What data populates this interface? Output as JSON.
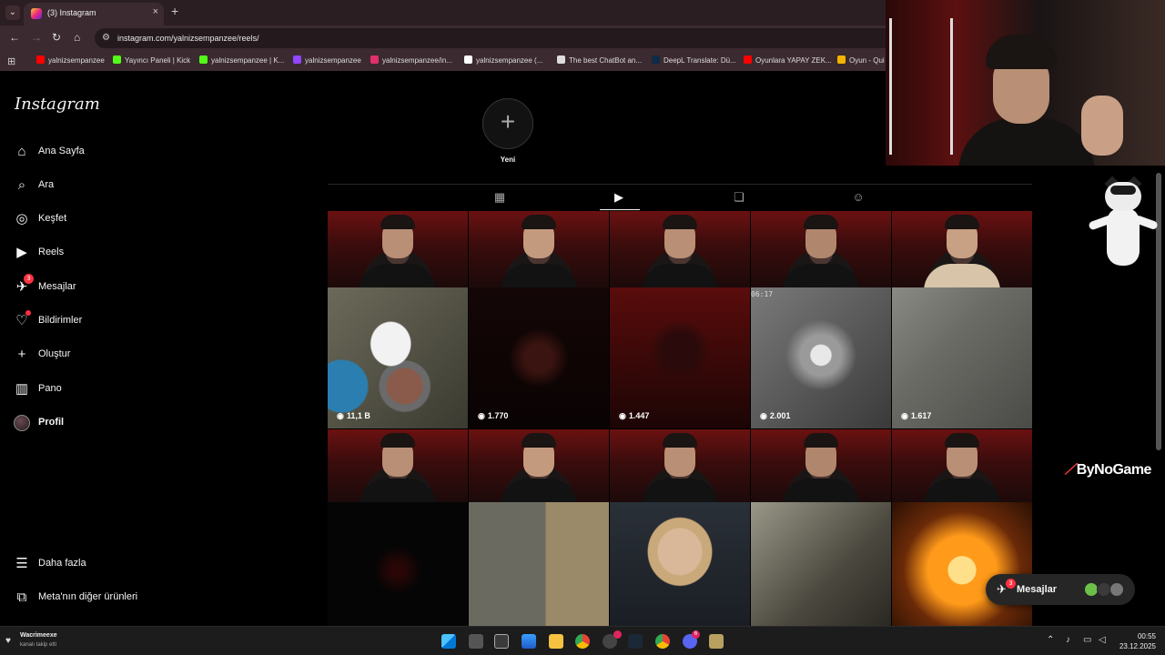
{
  "browser": {
    "tab_title": "(3) Instagram",
    "url": "instagram.com/yalnizsempanzee/reels/",
    "bookmarks": [
      {
        "label": "yalnizsempanzee",
        "color": "#ff0000"
      },
      {
        "label": "Yayıncı Paneli | Kick",
        "color": "#53fc18"
      },
      {
        "label": "yalnizsempanzee | K...",
        "color": "#53fc18"
      },
      {
        "label": "yalnizsempanzee",
        "color": "#9146ff"
      },
      {
        "label": "yalnizsempanzee/in...",
        "color": "#e1306c"
      },
      {
        "label": "yalnizsempanzee (...",
        "color": "#ffffff"
      },
      {
        "label": "The best ChatBot an...",
        "color": "#dddddd"
      },
      {
        "label": "DeepL Translate: Dü...",
        "color": "#0f2b46"
      },
      {
        "label": "Oyunlara YAPAY ZEK...",
        "color": "#ff0000"
      },
      {
        "label": "Oyun - Qui",
        "color": "#f4b400"
      }
    ]
  },
  "sidebar": {
    "logo": "Instagram",
    "items": [
      {
        "label": "Ana Sayfa",
        "icon": "home-icon",
        "glyph": "⌂"
      },
      {
        "label": "Ara",
        "icon": "search-icon",
        "glyph": "⌕"
      },
      {
        "label": "Keşfet",
        "icon": "explore-icon",
        "glyph": "◎"
      },
      {
        "label": "Reels",
        "icon": "reels-icon",
        "glyph": "▶"
      },
      {
        "label": "Mesajlar",
        "icon": "messages-icon",
        "glyph": "✈",
        "badge": "3"
      },
      {
        "label": "Bildirimler",
        "icon": "heart-icon",
        "glyph": "♡"
      },
      {
        "label": "Oluştur",
        "icon": "plus-icon",
        "glyph": "+"
      },
      {
        "label": "Pano",
        "icon": "dashboard-icon",
        "glyph": "▥"
      },
      {
        "label": "Profil",
        "icon": "avatar"
      }
    ],
    "more": "Daha fazla",
    "meta": "Meta'nın diğer ürünleri"
  },
  "highlight": {
    "new_label": "Yeni"
  },
  "profile_tabs": [
    {
      "name": "posts-tab",
      "icon": "grid-icon",
      "glyph": "▦"
    },
    {
      "name": "reels-tab",
      "icon": "reels-icon",
      "glyph": "▶",
      "active": true
    },
    {
      "name": "saved-tab",
      "icon": "bookmark-icon",
      "glyph": "❏"
    },
    {
      "name": "tagged-tab",
      "icon": "tagged-icon",
      "glyph": "☺"
    }
  ],
  "reels": {
    "row2_views": [
      "11,1 B",
      "1.770",
      "1.447",
      "2.001",
      "1.617"
    ],
    "timecode": "06:17"
  },
  "overlay": {
    "watermark": "ByNoGame",
    "messages_label": "Mesajlar",
    "messages_badge": "3"
  },
  "taskbar": {
    "weather_title": "Wacrimeexe",
    "weather_sub": "kanalı takip etti",
    "time": "00:55",
    "date": "23.12.2025",
    "discord_badge": "6"
  }
}
